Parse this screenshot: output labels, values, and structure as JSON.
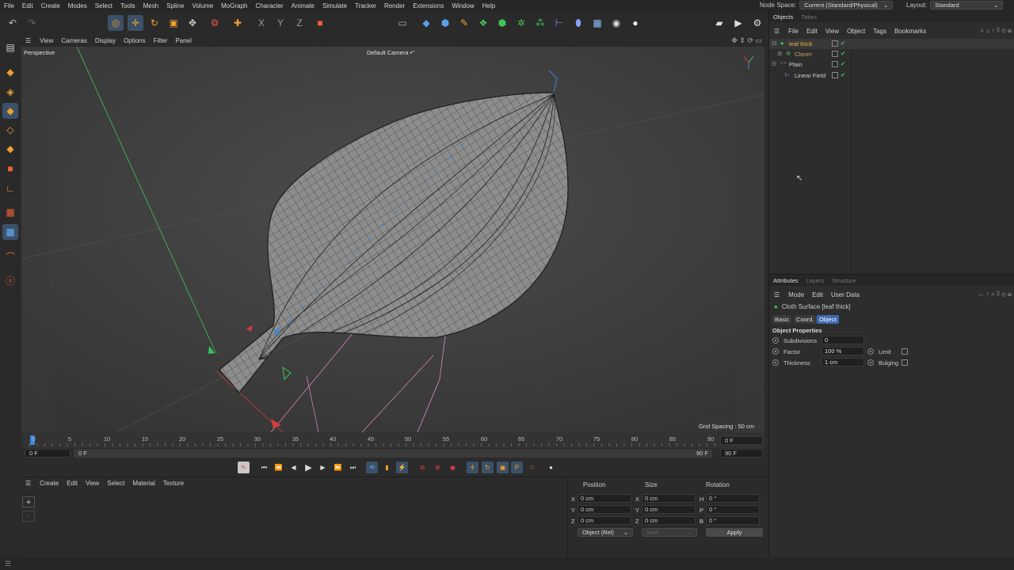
{
  "menu": [
    "File",
    "Edit",
    "Create",
    "Modes",
    "Select",
    "Tools",
    "Mesh",
    "Spline",
    "Volume",
    "MoGraph",
    "Character",
    "Animate",
    "Simulate",
    "Tracker",
    "Render",
    "Extensions",
    "Window",
    "Help"
  ],
  "node_space": {
    "label": "Node Space:",
    "value": "Current (Standard/Physical)"
  },
  "layout": {
    "label": "Layout:",
    "value": "Standard"
  },
  "viewport": {
    "menu": [
      "View",
      "Cameras",
      "Display",
      "Options",
      "Filter",
      "Panel"
    ],
    "name": "Perspective",
    "camera": "Default Camera",
    "camera_glyph": "•°",
    "grid_spacing": "Grid Spacing : 50 cm"
  },
  "timeline": {
    "ticks": [
      "0",
      "5",
      "10",
      "15",
      "20",
      "25",
      "30",
      "35",
      "40",
      "45",
      "50",
      "55",
      "60",
      "65",
      "70",
      "75",
      "80",
      "85",
      "90"
    ],
    "current_frame": "0 F",
    "start_field": "0 F",
    "range_start": "0 F",
    "range_end": "90 F",
    "end_field": "90 F",
    "end_frame": "0 F"
  },
  "material_manager": {
    "menu": [
      "Create",
      "Edit",
      "View",
      "Select",
      "Material",
      "Texture"
    ]
  },
  "coordinates": {
    "headers": {
      "position": "Position",
      "size": "Size",
      "rotation": "Rotation"
    },
    "rows": [
      {
        "axis": "X",
        "pos": "0 cm",
        "size_axis": "X",
        "size": "0 cm",
        "rot_axis": "H",
        "rot": "0 °"
      },
      {
        "axis": "Y",
        "pos": "0 cm",
        "size_axis": "Y",
        "size": "0 cm",
        "rot_axis": "P",
        "rot": "0 °"
      },
      {
        "axis": "Z",
        "pos": "0 cm",
        "size_axis": "Z",
        "size": "0 cm",
        "rot_axis": "B",
        "rot": "0 °"
      }
    ],
    "mode_select": "Object (Rel)",
    "size_select": "Size",
    "apply_label": "Apply"
  },
  "objects_panel": {
    "tabs": [
      "Objects",
      "Takes"
    ],
    "menu": [
      "File",
      "Edit",
      "View",
      "Object",
      "Tags",
      "Bookmarks"
    ],
    "items": [
      {
        "name": "leaf thick",
        "color": "#e3b545"
      },
      {
        "name": "Cloner",
        "color": "#c9a06a"
      },
      {
        "name": "Plain",
        "color": "#cfcfcf"
      },
      {
        "name": "Linear Field",
        "color": "#cfcfcf"
      }
    ]
  },
  "attributes_panel": {
    "tabs": [
      "Attributes",
      "Layers",
      "Structure"
    ],
    "menu": [
      "Mode",
      "Edit",
      "User Data"
    ],
    "object_title": "Cloth Surface [leaf thick]",
    "subtabs": [
      "Basic",
      "Coord.",
      "Object"
    ],
    "section": "Object Properties",
    "props": [
      {
        "label": "Subdivisions",
        "value": "0"
      },
      {
        "label": "Factor",
        "value": "100 %",
        "extra": "Limit"
      },
      {
        "label": "Thickness",
        "value": "1 cm",
        "extra": "Bulging"
      }
    ]
  },
  "colors": {
    "accent": "#4a7fc1",
    "selected_tab": "#3e6bb3",
    "object_green": "#3ec45a",
    "axis_x": "#d33c3c",
    "axis_y": "#3ec45a",
    "axis_z": "#3f86d8"
  }
}
